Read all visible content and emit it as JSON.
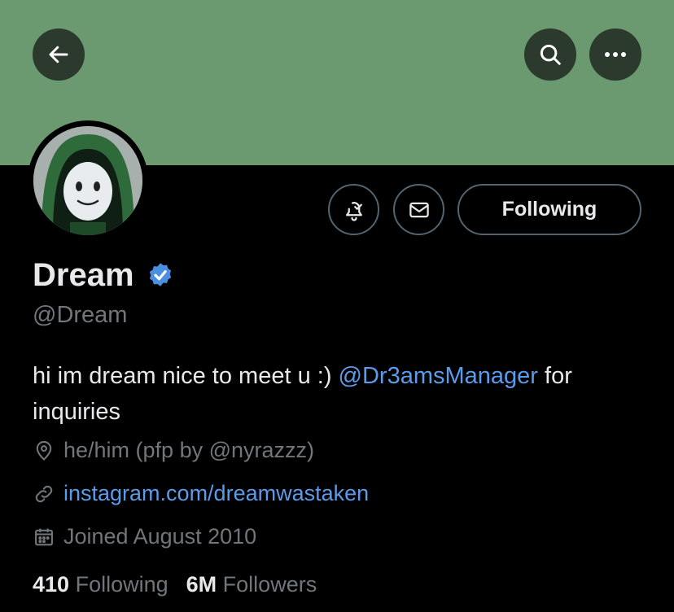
{
  "header": {
    "back_icon": "arrow-left-icon",
    "search_icon": "search-icon",
    "more_icon": "more-horizontal-icon",
    "banner_color": "#6b9a71"
  },
  "profile": {
    "name": "Dream",
    "verified_icon": "verified-badge-icon",
    "handle": "@Dream",
    "bio_text": "hi im dream nice to meet u :) ",
    "bio_mention": "@Dr3amsManager",
    "bio_after": " for inquiries",
    "location": "he/him (pfp by @nyrazzz)",
    "website": "instagram.com/dreamwastaken",
    "joined": "Joined August 2010"
  },
  "actions": {
    "notify_icon": "bell-check-icon",
    "message_icon": "mail-icon",
    "follow_label": "Following"
  },
  "stats": {
    "following_count": "410",
    "following_label": "Following",
    "followers_count": "6M",
    "followers_label": "Followers"
  },
  "colors": {
    "accent": "#5a9bea",
    "muted": "#71767b"
  }
}
